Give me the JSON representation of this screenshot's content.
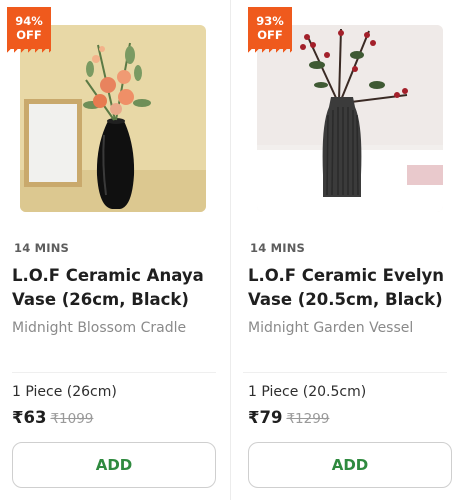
{
  "colors": {
    "badge": "#ef5a1d",
    "add_text": "#2f8a3f",
    "title": "#1f1f1f"
  },
  "products": [
    {
      "badge_line1": "94%",
      "badge_line2": "OFF",
      "delivery": "14 MINS",
      "title": "L.O.F Ceramic Anaya Vase (26cm, Black)",
      "subtitle": "Midnight Blossom Cradle",
      "quantity": "1 Piece (26cm)",
      "price": "₹63",
      "mrp": "₹1099",
      "add_label": "ADD",
      "image_icon": "black-vase-with-flowers-image"
    },
    {
      "badge_line1": "93%",
      "badge_line2": "OFF",
      "delivery": "14 MINS",
      "title": "L.O.F Ceramic Evelyn Vase (20.5cm, Black)",
      "subtitle": "Midnight Garden Vessel",
      "quantity": "1 Piece (20.5cm)",
      "price": "₹79",
      "mrp": "₹1299",
      "add_label": "ADD",
      "image_icon": "ribbed-vase-with-berries-image"
    }
  ]
}
